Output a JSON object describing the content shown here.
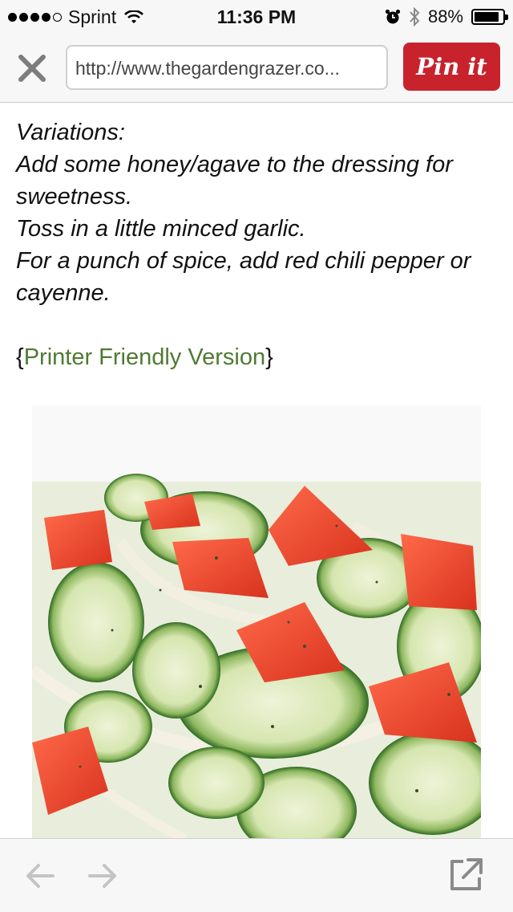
{
  "status_bar": {
    "carrier": "Sprint",
    "time": "11:36 PM",
    "battery_percent": "88%",
    "battery_level": 0.88,
    "signal_bars_filled": 4,
    "signal_bars_total": 5
  },
  "toolbar": {
    "close_icon": "close-icon",
    "url": "http://www.thegardengrazer.co...",
    "pin_label": "Pin it",
    "pin_color": "#c8232c"
  },
  "content": {
    "lines": [
      "Variations:",
      "Add some honey/agave to the dressing for sweetness.",
      "Toss in a little minced garlic.",
      "For a punch of spice, add red chili pepper or cayenne."
    ],
    "printer_open": "{",
    "printer_link": "Printer Friendly Version",
    "printer_close": "}",
    "link_color": "#4f7a33"
  },
  "image": {
    "icon": "salad-photo"
  },
  "bottom_bar": {
    "back_icon": "back-arrow-icon",
    "forward_icon": "forward-arrow-icon",
    "share_icon": "open-external-icon"
  }
}
